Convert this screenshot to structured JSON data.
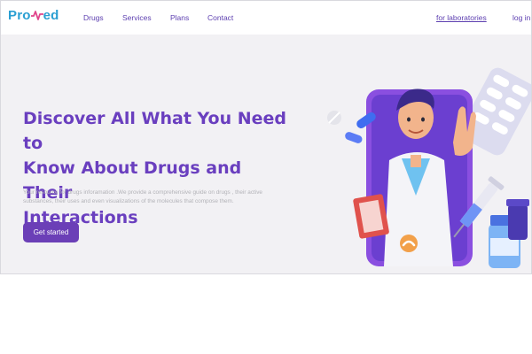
{
  "brand": {
    "logo_part1": "Pro",
    "logo_part2": "ed"
  },
  "nav": {
    "links": [
      "Drugs",
      "Services",
      "Plans",
      "Contact"
    ],
    "labs_link": "for laboratories",
    "login_link": "log in"
  },
  "hero": {
    "title_lines": [
      "Discover All What You Need to",
      "Know About Drugs and Their",
      "Interactions"
    ],
    "subtitle_lines": [
      "Your resource for drugs inforamation .We provide a comprehensive guide on drugs , their active",
      "substances, their uses and even visualizations of the molecules that compose them."
    ],
    "cta_label": "Get started"
  },
  "colors": {
    "accent": "#6b3fb7",
    "brand": "#2a9fd2",
    "background": "#f2f1f4"
  },
  "icons": {
    "logo_pulse": "heartbeat-pulse-icon"
  }
}
